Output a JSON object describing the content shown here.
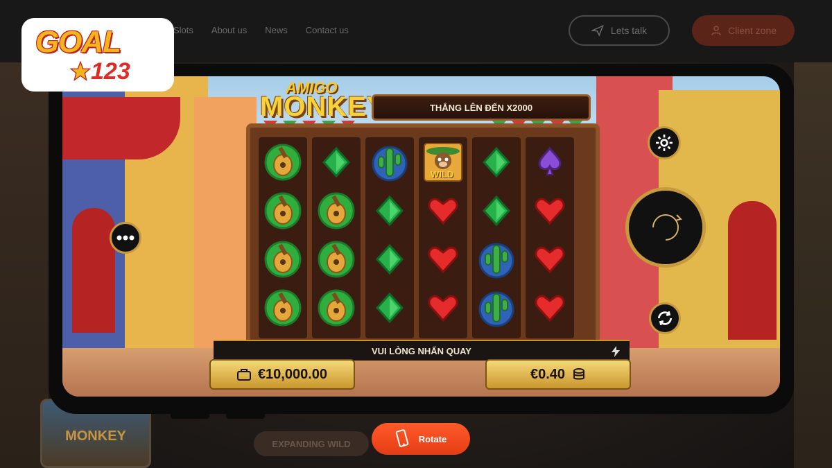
{
  "nav": {
    "links": [
      "Slots",
      "About us",
      "News",
      "Contact us"
    ],
    "lets_talk": "Lets talk",
    "client_zone": "Client zone"
  },
  "logo": {
    "word": "GOAL",
    "number": "123"
  },
  "game": {
    "title_top": "AMIGO",
    "title_main": "MONKEY",
    "win_banner": "THẮNG LÊN ĐẾN X2000",
    "status": "VUI LÒNG NHẤN QUAY",
    "balance": "€10,000.00",
    "bet": "€0.40",
    "wild_label": "WILD",
    "reels": [
      [
        "guitar",
        "guitar",
        "guitar",
        "guitar"
      ],
      [
        "diamond-green",
        "guitar",
        "guitar",
        "guitar"
      ],
      [
        "cactus",
        "diamond-green",
        "diamond-green",
        "diamond-green"
      ],
      [
        "wild-monkey",
        "heart-red",
        "heart-red",
        "heart-red"
      ],
      [
        "diamond-green",
        "diamond-green",
        "cactus",
        "cactus"
      ],
      [
        "spade-purple",
        "heart-red",
        "heart-red",
        "heart-red"
      ]
    ]
  },
  "bottom": {
    "expanding_wild": "EXPANDING WILD",
    "rotate": "Rotate",
    "thumb_title": "MONKEY"
  },
  "colors": {
    "accent": "#ff5a2a",
    "gold": "#f6d878",
    "brown": "#6b3a1c"
  }
}
